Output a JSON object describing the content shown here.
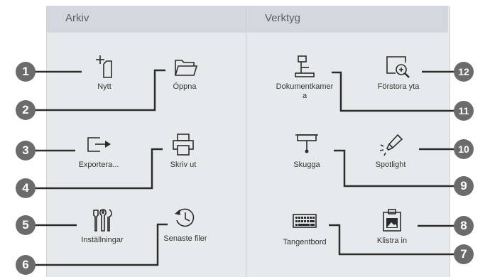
{
  "headers": {
    "arkiv": "Arkiv",
    "verktyg": "Verktyg"
  },
  "tools": {
    "nytt": "Nytt",
    "oppna": "Öppna",
    "exportera": "Exportera...",
    "skriv_ut": "Skriv ut",
    "installningar": "Inställningar",
    "senaste_filer": "Senaste filer",
    "dokumentkamera": "Dokumentkamer a",
    "forstora_yta": "Förstora yta",
    "skugga": "Skugga",
    "spotlight": "Spotlight",
    "tangentbord": "Tangentbord",
    "klistra_in": "Klistra in"
  },
  "callouts": [
    "1",
    "2",
    "3",
    "4",
    "5",
    "6",
    "7",
    "8",
    "9",
    "10",
    "11",
    "12"
  ]
}
